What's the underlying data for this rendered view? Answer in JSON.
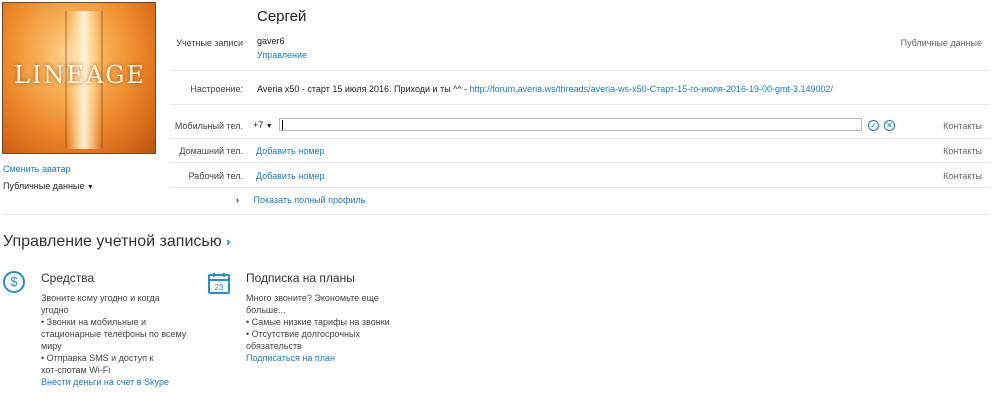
{
  "profile": {
    "name": "Сергей",
    "change_avatar": "Сменить аватар",
    "public_data_dropdown": "Публичные данные",
    "avatar_logo_text": "LINEAGE"
  },
  "accounts": {
    "label": "Учетные записи",
    "value": "gaver6",
    "manage_link": "Управление",
    "visibility": "Публичные данные"
  },
  "mood": {
    "label": "Настроение:",
    "text": "Averia x50 - старт 15 июля 2016. Приходи и ты ^^ - ",
    "link": "http://forum.averia.ws/threads/averia-ws-x50-Старт-15-го-июля-2016-19-00-gmt-3.149002/"
  },
  "phones": {
    "mobile": {
      "label": "Мобильный тел.",
      "country_code": "+7",
      "value": "",
      "visibility": "Контакты"
    },
    "home": {
      "label": "Домашний тел.",
      "add": "Добавить номер",
      "visibility": "Контакты"
    },
    "work": {
      "label": "Рабочий тел.",
      "add": "Добавить номер",
      "visibility": "Контакты"
    }
  },
  "show_full_profile": "Показать полный профиль",
  "account_management": {
    "title": "Управление учетной записью",
    "funds": {
      "title": "Средства",
      "lines": [
        "Звоните кому угодно и когда",
        "угодно",
        "• Звонки на мобильные и",
        "стационарные телефоны по всему",
        "миру",
        "• Отправка SMS и доступ к",
        "хот-спотам Wi-Fi"
      ],
      "link": "Внести деньги на счет в Skype"
    },
    "subscription": {
      "title": "Подписка на планы",
      "calendar_day": "23",
      "lines": [
        "Много звоните? Экономьте еще",
        "больше...",
        "• Самые низкие тарифы на звонки",
        "• Отсутствие долгосрочных",
        "обязательств"
      ],
      "link": "Подписаться на план"
    }
  },
  "colors": {
    "link": "#1f7ab8",
    "accent_icon": "#2a8fc8"
  }
}
